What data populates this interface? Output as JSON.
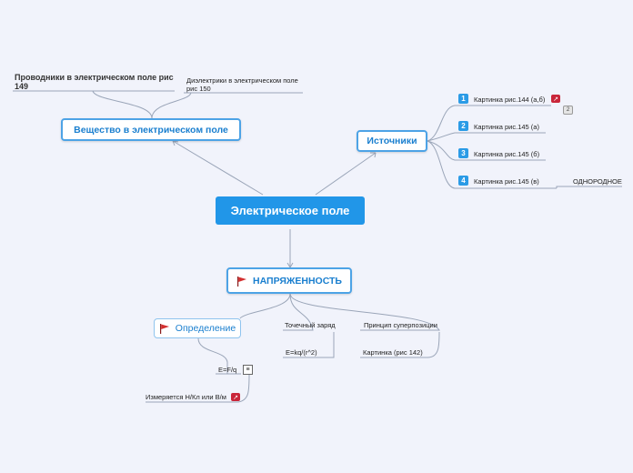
{
  "central": "Электрическое поле",
  "substance": {
    "title": "Вещество в электрическом поле",
    "children": [
      "Проводники в электрическом поле рис 149",
      "Диэлектрики в электрическом поле рис 150"
    ]
  },
  "sources": {
    "title": "Источники",
    "items": [
      {
        "num": "1",
        "label": "Картинка рис.144 (а,б)"
      },
      {
        "num": "2",
        "label": "Картинка рис.145 (а)"
      },
      {
        "num": "3",
        "label": "Картинка рис.145 (б)"
      },
      {
        "num": "4",
        "label": "Картинка рис.145 (в)"
      }
    ],
    "extra": "ОДНОРОДНОЕ",
    "badge": "2"
  },
  "tension": {
    "title": "НАПРЯЖЕННОСТЬ",
    "definition": "Определение",
    "def_children": [
      "E=F/q",
      "Измеряется Н/Кл  или В/м"
    ],
    "point_charge": "Точечный заряд",
    "point_formula": "E=kq/(r^2)",
    "superposition": "Принцип суперпозиции",
    "superposition_child": "Картинка (рис 142)"
  },
  "colors": {
    "accent": "#2196e8",
    "flag": "#d32f2f",
    "line": "#9aa5b8"
  }
}
